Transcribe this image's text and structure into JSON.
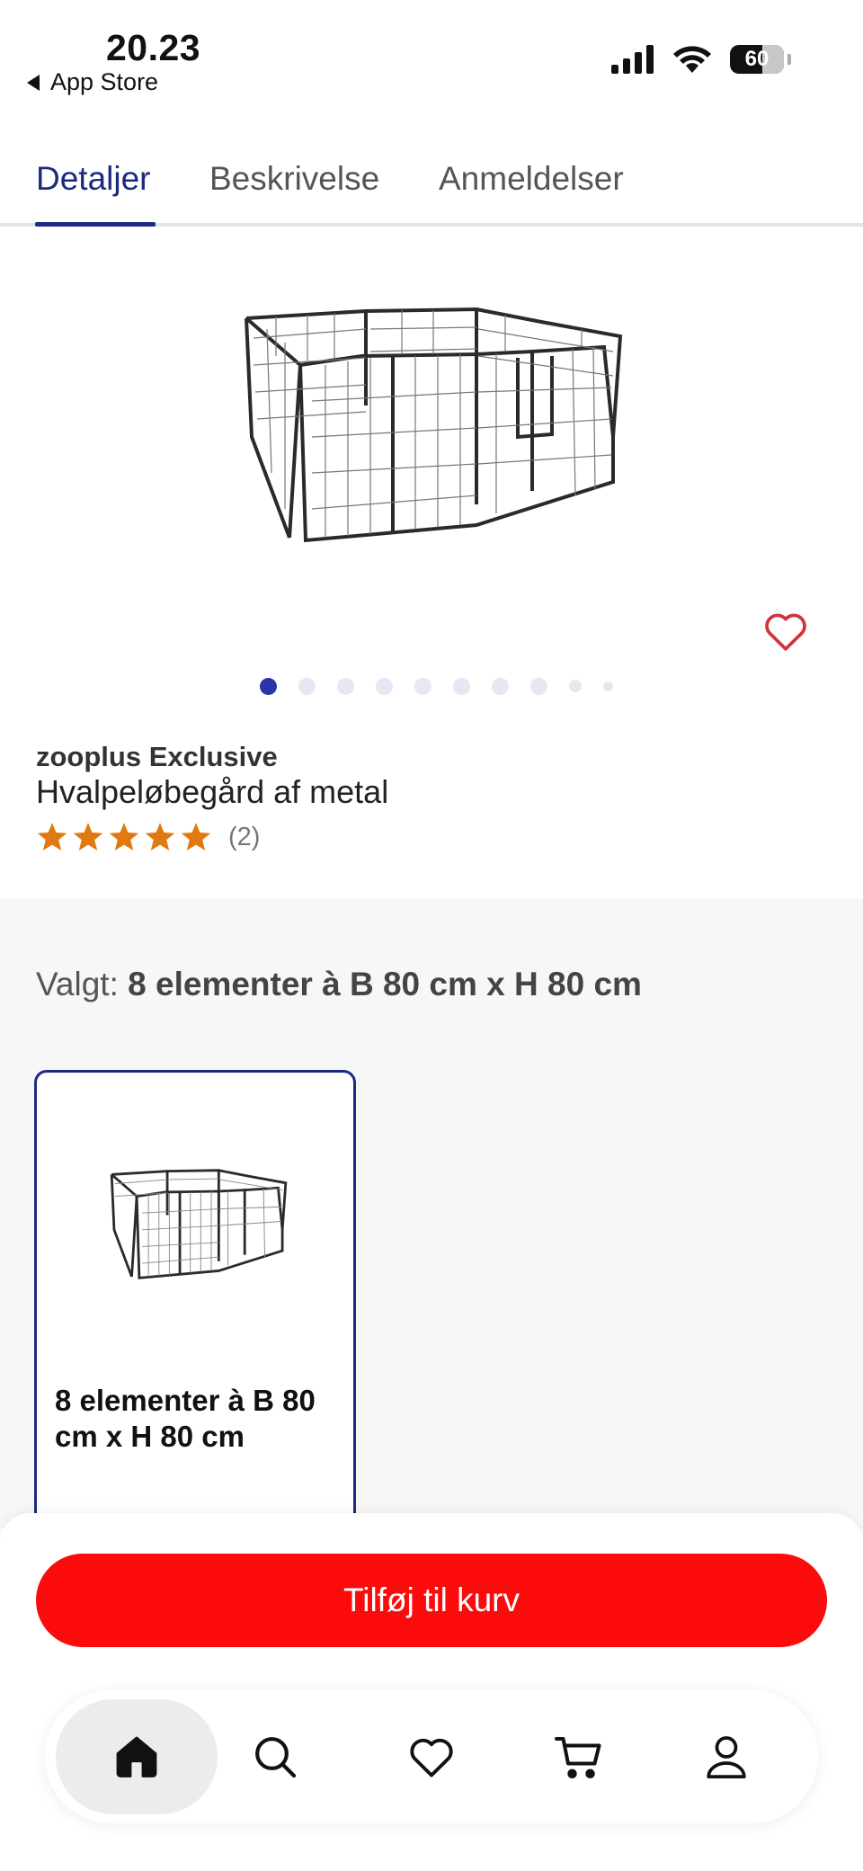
{
  "status_bar": {
    "time": "20.23",
    "back_label": "App Store",
    "battery": "60"
  },
  "tabs": [
    {
      "label": "Detaljer",
      "active": true
    },
    {
      "label": "Beskrivelse",
      "active": false
    },
    {
      "label": "Anmeldelser",
      "active": false
    }
  ],
  "gallery": {
    "total_images": 10,
    "current_index": 1
  },
  "product": {
    "brand": "zooplus Exclusive",
    "title": "Hvalpeløbegård af metal",
    "rating_stars": 5,
    "rating_count": "(2)"
  },
  "variant": {
    "chosen_prefix": "Valgt:",
    "chosen_value": "8 elementer à B 80 cm x H 80 cm",
    "options": [
      {
        "label": "8 elementer à B 80 cm x H 80 cm",
        "selected": true
      }
    ]
  },
  "actions": {
    "add_to_cart": "Tilføj til kurv"
  },
  "nav": [
    {
      "icon": "home-icon",
      "active": true
    },
    {
      "icon": "search-icon",
      "active": false
    },
    {
      "icon": "heart-icon",
      "active": false
    },
    {
      "icon": "cart-icon",
      "active": false
    },
    {
      "icon": "profile-icon",
      "active": false
    }
  ],
  "colors": {
    "accent": "#1c2a80",
    "cta": "#fb0b0b",
    "star": "#e07a10",
    "favorite": "#d0343a"
  }
}
